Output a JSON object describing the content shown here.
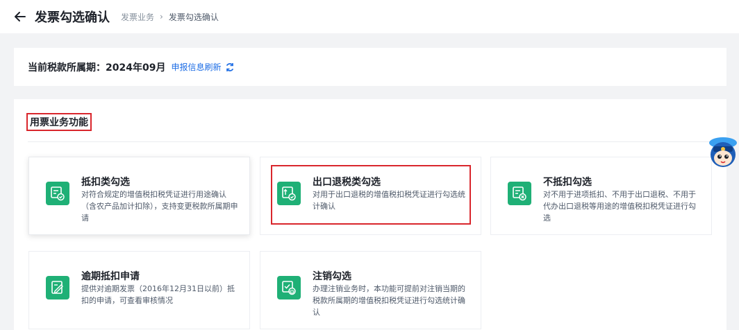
{
  "header": {
    "title": "发票勾选确认",
    "breadcrumb_parent": "发票业务",
    "breadcrumb_sep": "›",
    "breadcrumb_current": "发票勾选确认"
  },
  "period": {
    "label": "当前税款所属期：2024年09月",
    "refresh_link": "申报信息刷新"
  },
  "section": {
    "title": "用票业务功能"
  },
  "functions": [
    {
      "title": "抵扣类勾选",
      "desc": "对符合规定的增值税扣税凭证进行用途确认（含农产品加计扣除），支持变更税款所属期申请",
      "icon": "deduction-check-icon"
    },
    {
      "title": "出口退税类勾选",
      "desc": "对用于出口退税的增值税扣税凭证进行勾选统计确认",
      "icon": "export-refund-icon"
    },
    {
      "title": "不抵扣勾选",
      "desc": "对不用于进项抵扣、不用于出口退税、不用于代办出口退税等用途的增值税扣税凭证进行勾选",
      "icon": "non-deduction-icon"
    },
    {
      "title": "逾期抵扣申请",
      "desc": "提供对逾期发票（2016年12月31日以前）抵扣的申请，可查看审核情况",
      "icon": "overdue-apply-icon"
    },
    {
      "title": "注销勾选",
      "desc": "办理注销业务时，本功能可提前对注销当期的税款所属期的增值税扣税凭证进行勾选统计确认",
      "icon": "cancellation-check-icon"
    }
  ],
  "colors": {
    "accent_green": "#1fb076",
    "link_blue": "#1d6de5",
    "highlight_red": "#d9262c"
  }
}
